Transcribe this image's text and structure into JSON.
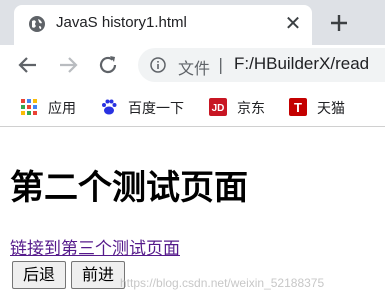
{
  "browser": {
    "tab": {
      "title": "JavaS history1.html",
      "close_glyph": "✕",
      "favicon": "globe-icon"
    },
    "new_tab_icon": "plus-icon",
    "toolbar": {
      "back_icon": "arrow-left-icon",
      "forward_icon": "arrow-right-icon",
      "reload_icon": "reload-icon"
    },
    "omnibox": {
      "security_label": "文件",
      "separator": "|",
      "url": "F:/HBuilderX/read"
    },
    "bookmarks": [
      {
        "label": "应用",
        "icon": "apps-grid-icon"
      },
      {
        "label": "百度一下",
        "icon": "baidu-paw-icon"
      },
      {
        "label": "京东",
        "icon": "jd-logo-icon",
        "icon_text": "JD",
        "color": "#c81623"
      },
      {
        "label": "天猫",
        "icon": "tmall-logo-icon",
        "icon_text": "T",
        "color": "#c40000"
      }
    ]
  },
  "page": {
    "heading": "第二个测试页面",
    "link_text": "链接到第三个测试页面",
    "buttons": {
      "back": "后退",
      "forward": "前进"
    }
  },
  "watermark": "https://blog.csdn.net/weixin_52188375"
}
